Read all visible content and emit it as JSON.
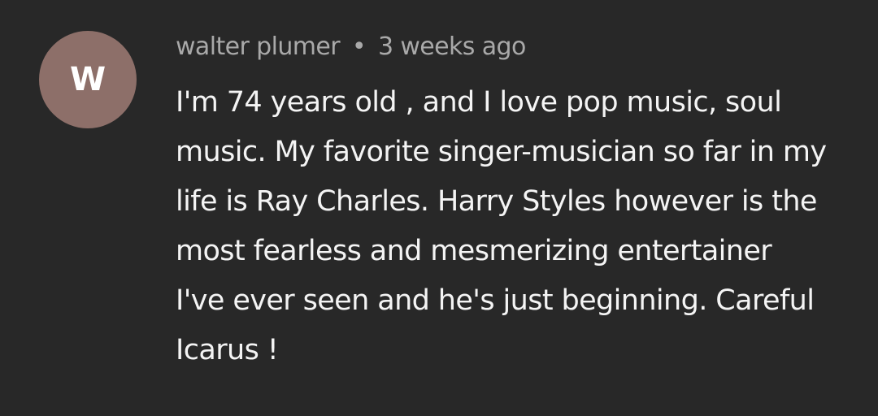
{
  "comment": {
    "avatar_letter": "W",
    "avatar_color": "#8d6f69",
    "author": "walter plumer",
    "separator": "•",
    "timestamp": "3 weeks ago",
    "lines": [
      "I'm 74 years old , and I love pop music, soul",
      "music. My favorite singer-musician so far in my",
      "life is Ray Charles. Harry Styles however is the",
      "most fearless and mesmerizing entertainer",
      "I've ever seen and he's just beginning. Careful",
      "Icarus !"
    ]
  },
  "colors": {
    "background": "#282828",
    "text": "#f4f4f4",
    "meta": "#a9a9a9"
  }
}
